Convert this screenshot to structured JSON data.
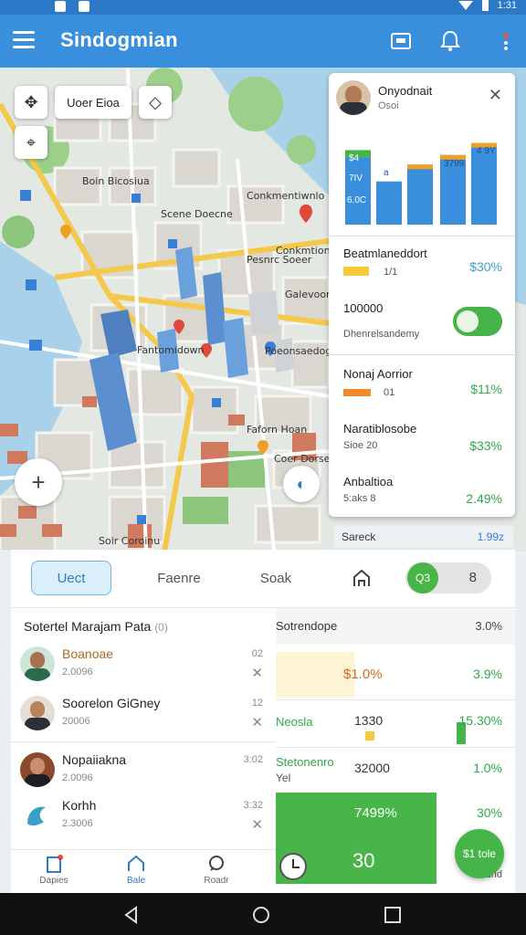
{
  "status_bar": {
    "time": "1:31"
  },
  "app_bar": {
    "title": "Sindogmian"
  },
  "map": {
    "search_chip": "Uoer Eioa",
    "labels": [
      "Boin Bicosiua",
      "Scene Doecne",
      "Conkmentiwnlo",
      "Conkmtionorls",
      "Pesnrc Soeer",
      "Fantomidown",
      "Galevoom",
      "Poeonsaedog",
      "Faforn Hoan",
      "Soir Coroinu",
      "Coer Dorsenc"
    ]
  },
  "profile_card": {
    "name": "Onyodnait",
    "sub": "Osoi",
    "chart": {
      "bar_labels": [
        "$4",
        "7IV",
        "6.0C",
        "a",
        "3799",
        "4 9Y"
      ],
      "values": [
        56,
        36,
        50,
        58,
        68
      ],
      "colors": [
        "#3a8fdc",
        "#3a8fdc",
        "#3a8fdc",
        "#3a8fdc",
        "#3a8fdc"
      ]
    },
    "rows": [
      {
        "title": "Beatmlaneddort",
        "sub": "1/1",
        "value": "$30%"
      },
      {
        "title": "100000",
        "sub": "Dhenrelsandemy",
        "value": ""
      },
      {
        "title": "Nonaj Aorrior",
        "sub": "01",
        "value": "$11%"
      },
      {
        "title": "Naratiblosobe",
        "sub": "Sioe  20",
        "value": "$33%"
      },
      {
        "title": "Anbaltioa",
        "sub": "5:aks  8",
        "value": "2.49%"
      }
    ],
    "toggle_on": true
  },
  "search_strip": {
    "label": "Sareck",
    "value": "1.99z"
  },
  "tabs": [
    {
      "label": "Uect",
      "active": true
    },
    {
      "label": "Faenre",
      "active": false
    },
    {
      "label": "Soak",
      "active": false
    }
  ],
  "toggle": {
    "on_label": "Q3",
    "off_label": "8"
  },
  "list": {
    "title": "Sotertel Marajam Pata",
    "title_count": "(0)",
    "items": [
      {
        "name": "Boanoae",
        "sub": "2.0096",
        "num": "02"
      },
      {
        "name": "Soorelon GiGney",
        "sub": "20006",
        "num": "12"
      },
      {
        "name": "Nopaiiakna",
        "sub": "2.0096",
        "num": "3:02"
      },
      {
        "name": "Korhh",
        "sub": "2.3006",
        "num": "3:32"
      }
    ]
  },
  "table": {
    "header": {
      "c1": "Sotrendope",
      "c3": "3.0%"
    },
    "rows": [
      {
        "c1": "",
        "c2": "$1.0%",
        "c3": "3.9%"
      },
      {
        "c1": "Neosla",
        "c2": "1330",
        "c3": "15.30%"
      },
      {
        "c1": "Stetonenro",
        "c1b": "Yel",
        "c2": "32000",
        "c3": "1.0%"
      },
      {
        "c1": "",
        "c2": "7499%",
        "c3": "30%"
      },
      {
        "c1": "",
        "c2": "30",
        "c3": "Fadnd"
      }
    ]
  },
  "bottom_nav": [
    {
      "label": "Dapies"
    },
    {
      "label": "Bale"
    },
    {
      "label": "Roadr"
    }
  ],
  "fab": {
    "label": "$1 tole"
  },
  "colors": {
    "primary": "#3a8fdc",
    "green": "#45b54a",
    "orange": "#f0a020"
  }
}
